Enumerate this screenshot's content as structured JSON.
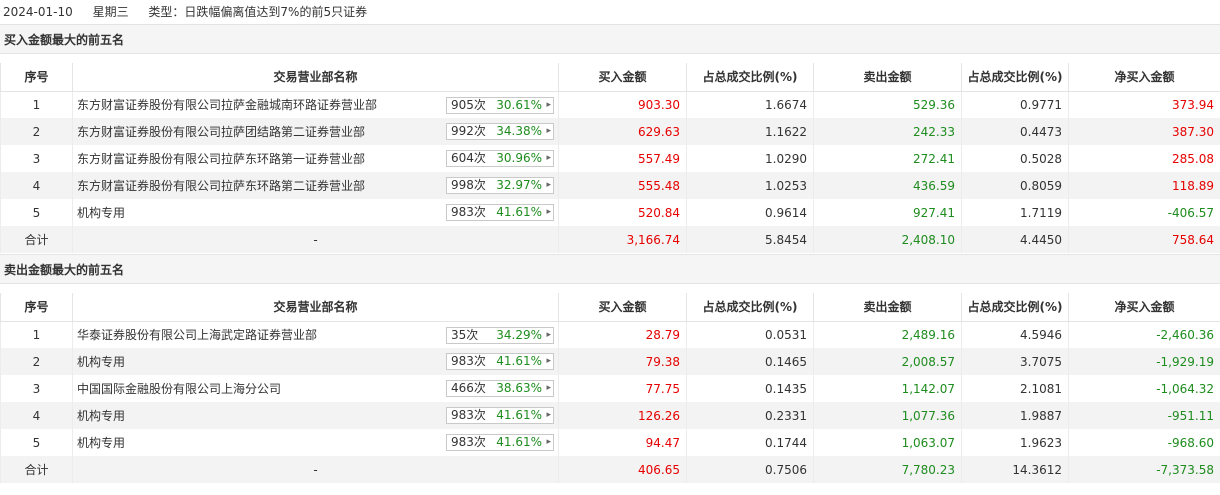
{
  "header": {
    "date": "2024-01-10",
    "weekday": "星期三",
    "type_text": "类型：日跌幅偏离值达到7%的前5只证券"
  },
  "columns": [
    "序号",
    "交易营业部名称",
    "买入金额",
    "占总成交比例(%)",
    "卖出金额",
    "占总成交比例(%)",
    "净买入金额"
  ],
  "buy_section": {
    "title": "买入金额最大的前五名",
    "rows": [
      {
        "idx": "1",
        "name": "东方财富证券股份有限公司拉萨金融城南环路证券营业部",
        "count": "905次",
        "pct": "30.61%",
        "buy": "903.30",
        "buy_ratio": "1.6674",
        "sell": "529.36",
        "sell_ratio": "0.9771",
        "net": "373.94",
        "net_color": "red"
      },
      {
        "idx": "2",
        "name": "东方财富证券股份有限公司拉萨团结路第二证券营业部",
        "count": "992次",
        "pct": "34.38%",
        "buy": "629.63",
        "buy_ratio": "1.1622",
        "sell": "242.33",
        "sell_ratio": "0.4473",
        "net": "387.30",
        "net_color": "red"
      },
      {
        "idx": "3",
        "name": "东方财富证券股份有限公司拉萨东环路第一证券营业部",
        "count": "604次",
        "pct": "30.96%",
        "buy": "557.49",
        "buy_ratio": "1.0290",
        "sell": "272.41",
        "sell_ratio": "0.5028",
        "net": "285.08",
        "net_color": "red"
      },
      {
        "idx": "4",
        "name": "东方财富证券股份有限公司拉萨东环路第二证券营业部",
        "count": "998次",
        "pct": "32.97%",
        "buy": "555.48",
        "buy_ratio": "1.0253",
        "sell": "436.59",
        "sell_ratio": "0.8059",
        "net": "118.89",
        "net_color": "red"
      },
      {
        "idx": "5",
        "name": "机构专用",
        "count": "983次",
        "pct": "41.61%",
        "buy": "520.84",
        "buy_ratio": "0.9614",
        "sell": "927.41",
        "sell_ratio": "1.7119",
        "net": "-406.57",
        "net_color": "green"
      }
    ],
    "total": {
      "label": "合计",
      "name": "-",
      "buy": "3,166.74",
      "buy_ratio": "5.8454",
      "sell": "2,408.10",
      "sell_ratio": "4.4450",
      "net": "758.64",
      "net_color": "red"
    }
  },
  "sell_section": {
    "title": "卖出金额最大的前五名",
    "rows": [
      {
        "idx": "1",
        "name": "华泰证券股份有限公司上海武定路证券营业部",
        "count": "35次",
        "pct": "34.29%",
        "buy": "28.79",
        "buy_ratio": "0.0531",
        "sell": "2,489.16",
        "sell_ratio": "4.5946",
        "net": "-2,460.36",
        "net_color": "green"
      },
      {
        "idx": "2",
        "name": "机构专用",
        "count": "983次",
        "pct": "41.61%",
        "buy": "79.38",
        "buy_ratio": "0.1465",
        "sell": "2,008.57",
        "sell_ratio": "3.7075",
        "net": "-1,929.19",
        "net_color": "green"
      },
      {
        "idx": "3",
        "name": "中国国际金融股份有限公司上海分公司",
        "count": "466次",
        "pct": "38.63%",
        "buy": "77.75",
        "buy_ratio": "0.1435",
        "sell": "1,142.07",
        "sell_ratio": "2.1081",
        "net": "-1,064.32",
        "net_color": "green"
      },
      {
        "idx": "4",
        "name": "机构专用",
        "count": "983次",
        "pct": "41.61%",
        "buy": "126.26",
        "buy_ratio": "0.2331",
        "sell": "1,077.36",
        "sell_ratio": "1.9887",
        "net": "-951.11",
        "net_color": "green"
      },
      {
        "idx": "5",
        "name": "机构专用",
        "count": "983次",
        "pct": "41.61%",
        "buy": "94.47",
        "buy_ratio": "0.1744",
        "sell": "1,063.07",
        "sell_ratio": "1.9623",
        "net": "-968.60",
        "net_color": "green"
      }
    ],
    "total": {
      "label": "合计",
      "name": "-",
      "buy": "406.65",
      "buy_ratio": "0.7506",
      "sell": "7,780.23",
      "sell_ratio": "14.3612",
      "net": "-7,373.58",
      "net_color": "green"
    }
  },
  "icons": {
    "count_expand": "chevron-right-icon"
  },
  "colors": {
    "buy": "#e60000",
    "sell": "#1e8c1e",
    "positive": "#e60000",
    "negative": "#1e8c1e"
  }
}
